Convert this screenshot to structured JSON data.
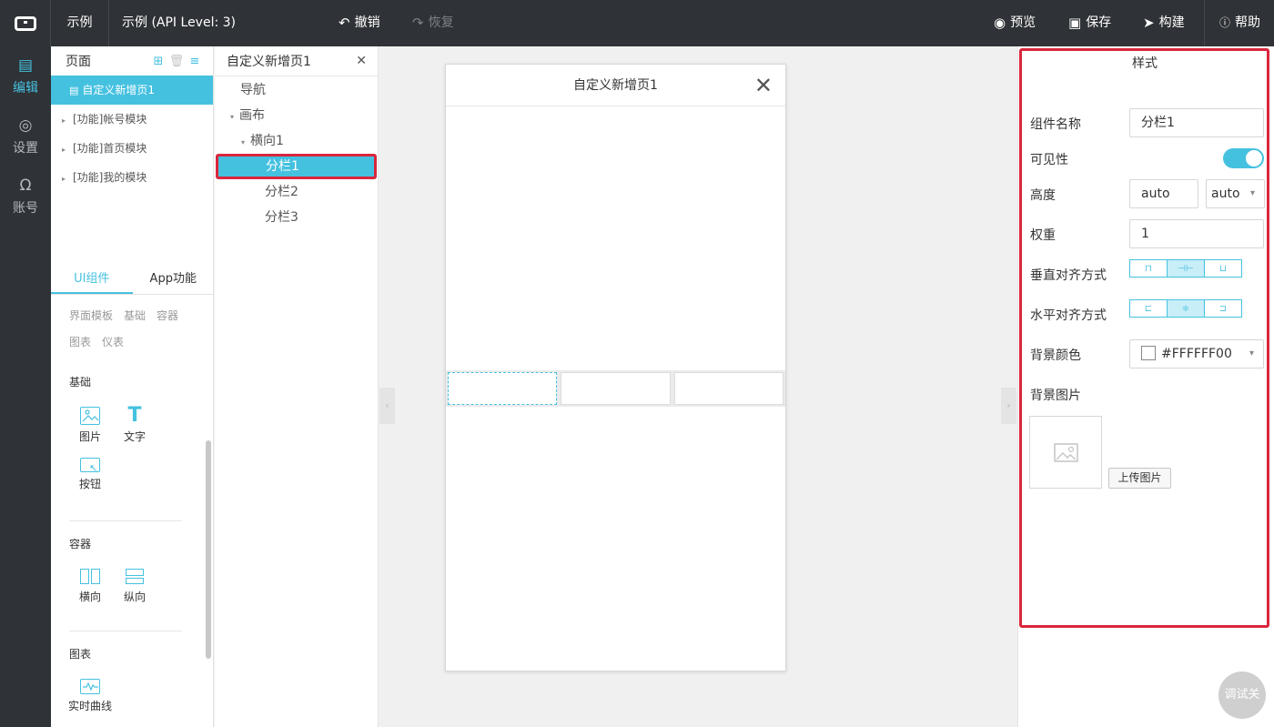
{
  "topbar": {
    "project": "示例",
    "title": "示例 (API Level: 3)",
    "undo": "撤销",
    "redo": "恢复",
    "preview": "预览",
    "save": "保存",
    "build": "构建",
    "help": "帮助"
  },
  "leftnav": {
    "items": [
      {
        "label": "编辑",
        "active": true
      },
      {
        "label": "设置"
      },
      {
        "label": "账号"
      }
    ]
  },
  "pages": {
    "title": "页面",
    "items": [
      {
        "label": "自定义新增页1",
        "active": true
      },
      {
        "label": "[功能]帐号模块"
      },
      {
        "label": "[功能]首页模块"
      },
      {
        "label": "[功能]我的模块"
      }
    ]
  },
  "components": {
    "tabs": [
      "UI组件",
      "App功能"
    ],
    "categories_row1": [
      "界面模板",
      "基础",
      "容器"
    ],
    "categories_row2": [
      "图表",
      "仪表"
    ],
    "groups": {
      "basic": {
        "title": "基础",
        "items": [
          "图片",
          "文字",
          "按钮"
        ]
      },
      "container": {
        "title": "容器",
        "items": [
          "横向",
          "纵向"
        ]
      },
      "chart": {
        "title": "图表",
        "items": [
          "实时曲线"
        ]
      }
    }
  },
  "tree": {
    "title": "自定义新增页1",
    "items": [
      "导航",
      "画布",
      "横向1",
      "分栏1",
      "分栏2",
      "分栏3"
    ]
  },
  "phone": {
    "title": "自定义新增页1"
  },
  "style": {
    "title": "样式",
    "name_label": "组件名称",
    "name_value": "分栏1",
    "visibility_label": "可见性",
    "height_label": "高度",
    "height_value": "auto",
    "height_unit": "auto",
    "weight_label": "权重",
    "weight_value": "1",
    "valign_label": "垂直对齐方式",
    "halign_label": "水平对齐方式",
    "bgcolor_label": "背景颜色",
    "bgcolor_value": "#FFFFFF00",
    "bgimage_label": "背景图片",
    "upload_label": "上传图片"
  },
  "debug": "调试关",
  "colors": {
    "accent": "#45c1e0",
    "highlight": "#d9263c",
    "dark": "#2f3236"
  }
}
